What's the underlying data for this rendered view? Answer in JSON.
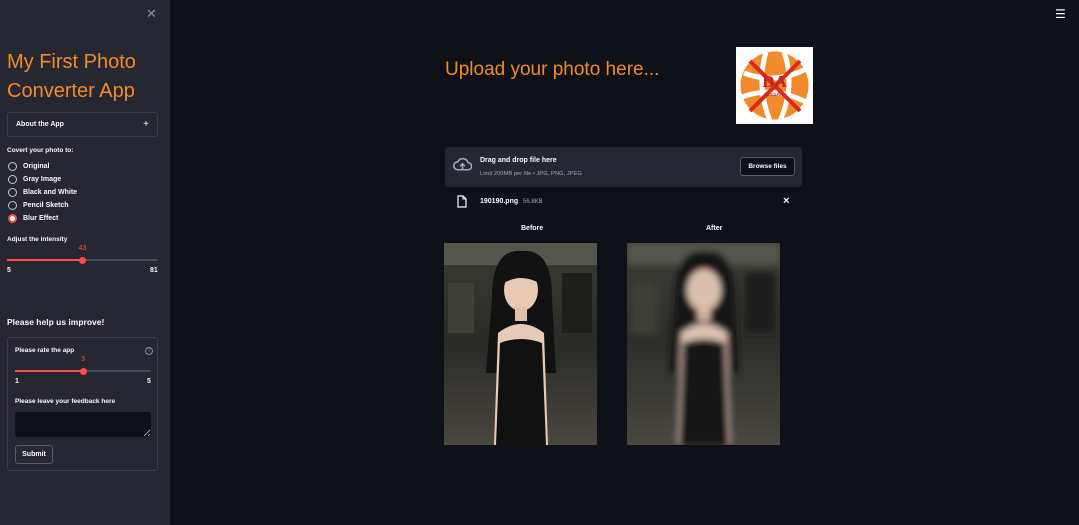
{
  "sidebar": {
    "close_icon": "close-icon",
    "title": "My First Photo Converter App",
    "about_label": "About the App",
    "about_icon": "+",
    "convert_label": "Covert your photo to:",
    "options": [
      "Original",
      "Gray Image",
      "Black and White",
      "Pencil Sketch",
      "Blur Effect"
    ],
    "selected_option": "Blur Effect",
    "intensity": {
      "label": "Adjust the intensity",
      "min": "5",
      "max": "81",
      "value": "43"
    },
    "improve_title": "Please help us improve!",
    "rating": {
      "label": "Please rate the app",
      "help": "?",
      "min": "1",
      "max": "5",
      "value": "3"
    },
    "feedback_label": "Please leave your feedback here",
    "submit_label": "Submit"
  },
  "main": {
    "menu_icon": "hamburger-menu-icon",
    "upload_title": "Upload your photo here...",
    "logo_text": "DA",
    "logo_subtext": "DataArt",
    "dropzone": {
      "title": "Drag and drop file here",
      "limit": "Limit 200MB per file • JPG, PNG, JPEG",
      "browse_label": "Browse files"
    },
    "file": {
      "name": "190190.png",
      "size": "56.8KB",
      "remove_icon": "×"
    },
    "before_label": "Before",
    "after_label": "After"
  },
  "colors": {
    "accent": "#ff4b4b",
    "title_orange": "#f18a2c",
    "sidebar_bg": "#262730",
    "main_bg": "#0e1117"
  }
}
